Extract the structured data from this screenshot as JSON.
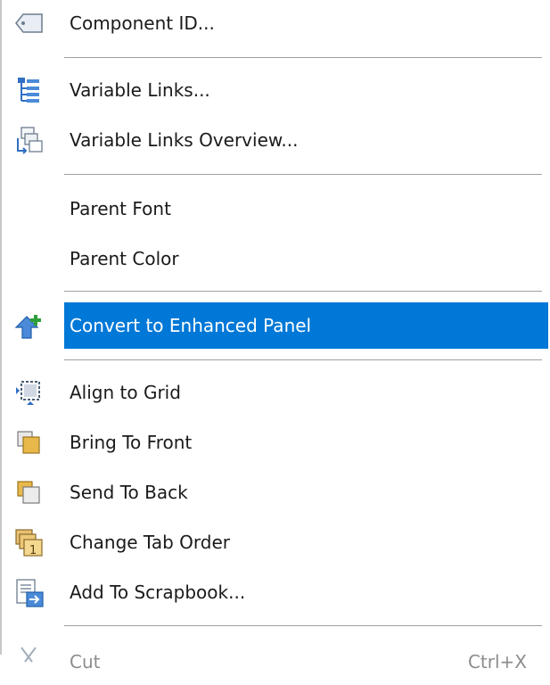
{
  "menu": {
    "items": [
      {
        "label": "Component ID...",
        "icon": "tag-icon"
      },
      {
        "label": "Variable Links...",
        "icon": "tree-links-icon"
      },
      {
        "label": "Variable Links Overview...",
        "icon": "links-overview-icon"
      },
      {
        "label": "Parent Font",
        "icon": ""
      },
      {
        "label": "Parent Color",
        "icon": ""
      },
      {
        "label": "Convert to Enhanced Panel",
        "icon": "convert-panel-icon",
        "highlighted": true
      },
      {
        "label": "Align to Grid",
        "icon": "align-grid-icon"
      },
      {
        "label": "Bring To Front",
        "icon": "bring-front-icon"
      },
      {
        "label": "Send To Back",
        "icon": "send-back-icon"
      },
      {
        "label": "Change Tab Order",
        "icon": "tab-order-icon"
      },
      {
        "label": "Add To Scrapbook...",
        "icon": "scrapbook-icon"
      },
      {
        "label": "Cut",
        "icon": "cut-icon",
        "shortcut": "Ctrl+X"
      }
    ]
  },
  "colors": {
    "highlight": "#0078d7",
    "separator": "#a0a0a0"
  }
}
